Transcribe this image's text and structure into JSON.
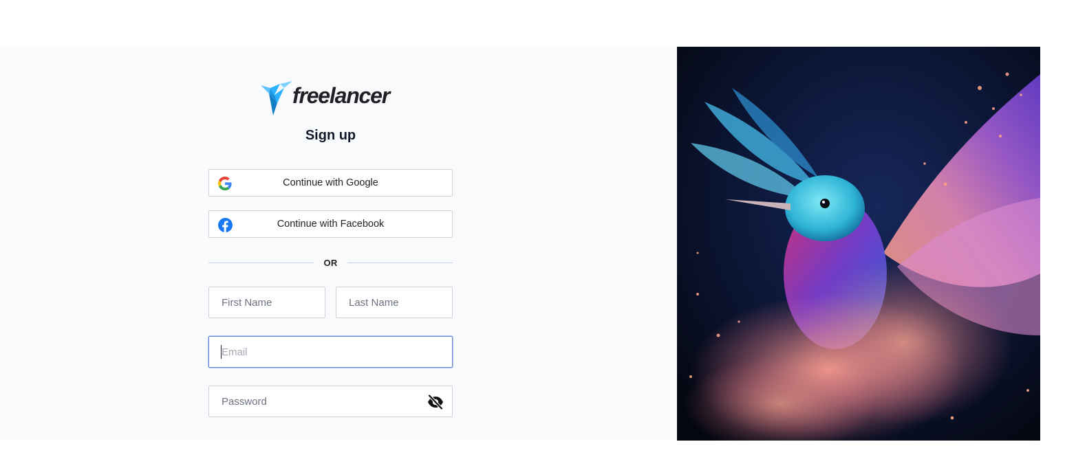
{
  "brand": {
    "name": "freelancer",
    "accent": "#29b2fe"
  },
  "signup": {
    "title": "Sign up",
    "google_label": "Continue with Google",
    "facebook_label": "Continue with Facebook",
    "divider_text": "OR",
    "first_name_placeholder": "First Name",
    "last_name_placeholder": "Last Name",
    "email_placeholder": "Email",
    "password_placeholder": "Password"
  },
  "icons": {
    "google": "google-g-icon",
    "facebook": "facebook-icon",
    "password_toggle": "eye-slash-icon",
    "logo_bird": "freelancer-bird-icon"
  },
  "colors": {
    "panel_bg": "#f9fafb",
    "focus_border": "#6d8bd7",
    "facebook_blue": "#1877f2"
  },
  "hero_image": {
    "subject": "hummingbird-color-explosion"
  }
}
